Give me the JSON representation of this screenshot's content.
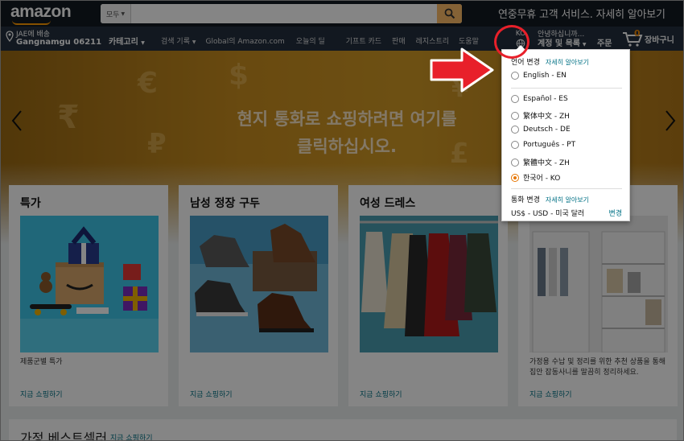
{
  "header": {
    "logo_text": "amazon",
    "search_category": "모두",
    "search_placeholder": "",
    "promo_text": "연중무휴 고객 서비스. 자세히 알아보기"
  },
  "nav": {
    "deliver_line1": "JAE에 배송",
    "deliver_line2": "Gangnamgu 06211",
    "categories": "카테고리",
    "links": [
      "검색 기록",
      "Global의 Amazon.com",
      "오늘의 딜",
      "기프트 카드",
      "판매",
      "레지스트리",
      "도움말"
    ],
    "lang_code": "KO",
    "account_line1": "안녕하십니까...",
    "account_line2": "계정 및 목록",
    "orders": "주문",
    "cart_count": "0",
    "cart_label": "장바구니"
  },
  "hero": {
    "line1": "현지 통화로 쇼핑하려면 여기를",
    "line2": "클릭하십시오."
  },
  "cards": [
    {
      "title": "특가",
      "desc": "제품군별 특가",
      "link": "지금 쇼핑하기"
    },
    {
      "title": "남성 정장 구두",
      "desc": "",
      "link": "지금 쇼핑하기"
    },
    {
      "title": "여성 드레스",
      "desc": "",
      "link": "지금 쇼핑하기"
    },
    {
      "title": "",
      "desc": "가정용 수납 및 정리를 위한 추천 상품을 통해 집안 잡동사니를 말끔히 정리하세요.",
      "link": "지금 쇼핑하기"
    }
  ],
  "bottom": {
    "title": "가정 베스트셀러",
    "link": "지금 쇼핑하기"
  },
  "dropdown": {
    "lang_heading": "언어 변경",
    "lang_learn": "자세히 알아보기",
    "languages": [
      {
        "label": "English - EN",
        "selected": false
      },
      {
        "label": "Español - ES",
        "selected": false
      },
      {
        "label": "繁体中文 - ZH",
        "selected": false
      },
      {
        "label": "Deutsch - DE",
        "selected": false
      },
      {
        "label": "Português - PT",
        "selected": false
      },
      {
        "label": "繁體中文 - ZH",
        "selected": false
      },
      {
        "label": "한국어 - KO",
        "selected": true
      }
    ],
    "currency_heading": "통화 변경",
    "currency_learn": "자세히 알아보기",
    "currency_value": "US$ - USD - 미국 달러",
    "currency_change": "변경"
  },
  "colors": {
    "topbar": "#131921",
    "navbar": "#232f3e",
    "accent": "#febd69",
    "link": "#007185",
    "annotation": "#e8202a"
  }
}
